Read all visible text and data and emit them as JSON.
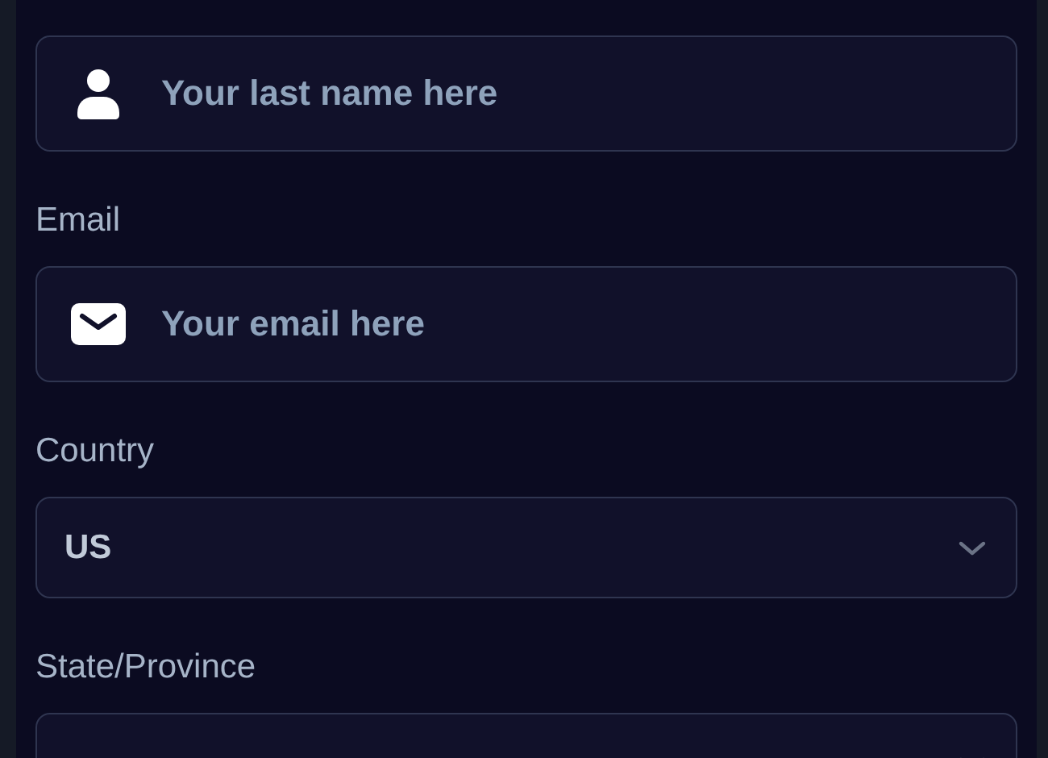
{
  "fields": [
    {
      "kind": "name",
      "placeholder": "Your last name here"
    },
    {
      "kind": "email",
      "label": "Email",
      "placeholder": "Your email here"
    },
    {
      "kind": "select",
      "label": "Country",
      "value": "US"
    },
    {
      "kind": "select",
      "label": "State/Province"
    }
  ]
}
